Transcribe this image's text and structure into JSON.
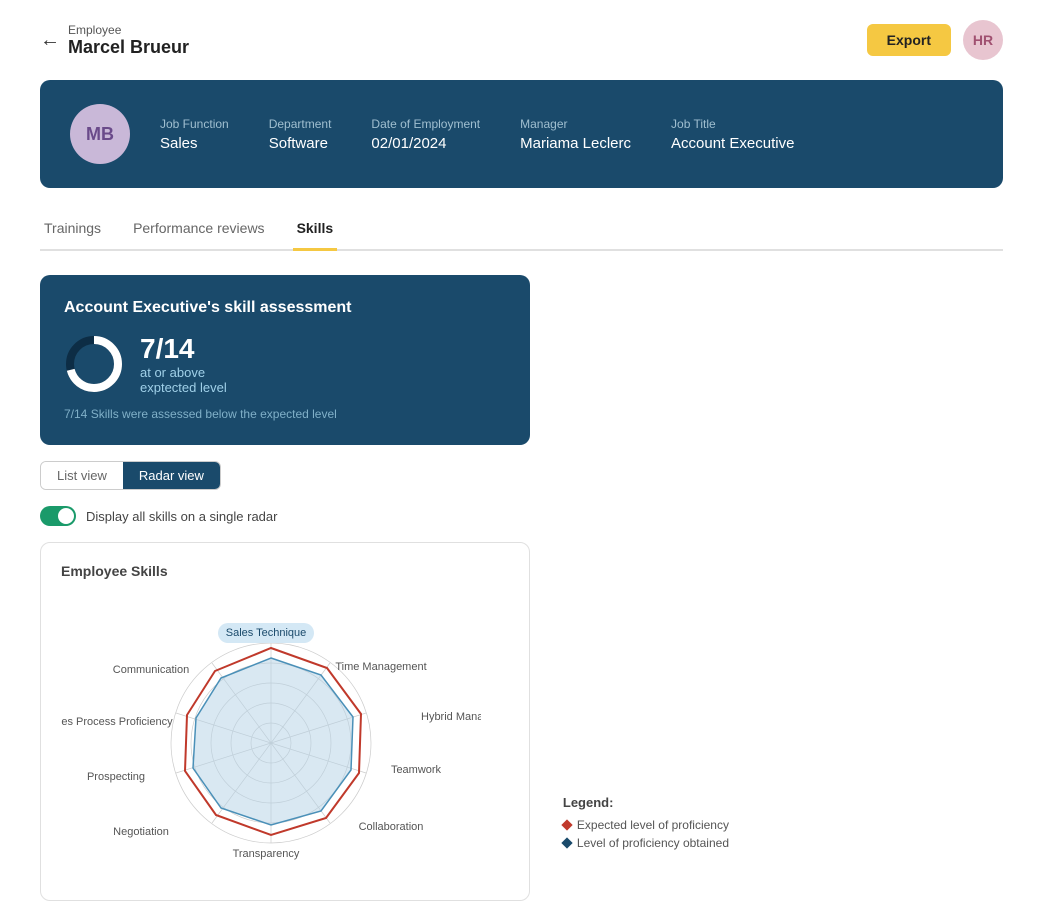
{
  "page": {
    "back_label": "Employee",
    "employee_name": "Marcel Brueur",
    "export_label": "Export",
    "avatar_initials": "HR"
  },
  "info_banner": {
    "avatar_initials": "MB",
    "fields": [
      {
        "label": "Job Function",
        "value": "Sales"
      },
      {
        "label": "Department",
        "value": "Software"
      },
      {
        "label": "Date of Employment",
        "value": "02/01/2024"
      },
      {
        "label": "Manager",
        "value": "Mariama Leclerc"
      },
      {
        "label": "Job Title",
        "value": "Account Executive"
      }
    ]
  },
  "tabs": [
    {
      "label": "Trainings",
      "active": false
    },
    {
      "label": "Performance reviews",
      "active": false
    },
    {
      "label": "Skills",
      "active": true
    }
  ],
  "skill_assessment": {
    "title": "Account Executive's skill assessment",
    "score": "7/14",
    "above_label": "at or above",
    "expected_label": "exptected level",
    "note": "7/14 Skills were assessed below the expected level"
  },
  "view_toggle": {
    "list_label": "List view",
    "radar_label": "Radar view",
    "active": "Radar view"
  },
  "display_toggle": {
    "label": "Display all skills on a single radar",
    "enabled": true
  },
  "skills_card": {
    "title": "Employee Skills",
    "axes": [
      "Sales Technique",
      "Time Management",
      "Hybrid Management",
      "Teamwork",
      "Collaboration",
      "Transparency",
      "Negotiation",
      "Prospecting",
      "Sales Process Proficiency",
      "Communication"
    ]
  },
  "legend": {
    "title": "Legend:",
    "items": [
      {
        "label": "Expected level of proficiency",
        "color": "red"
      },
      {
        "label": "Level of proficiency obtained",
        "color": "blue"
      }
    ]
  }
}
